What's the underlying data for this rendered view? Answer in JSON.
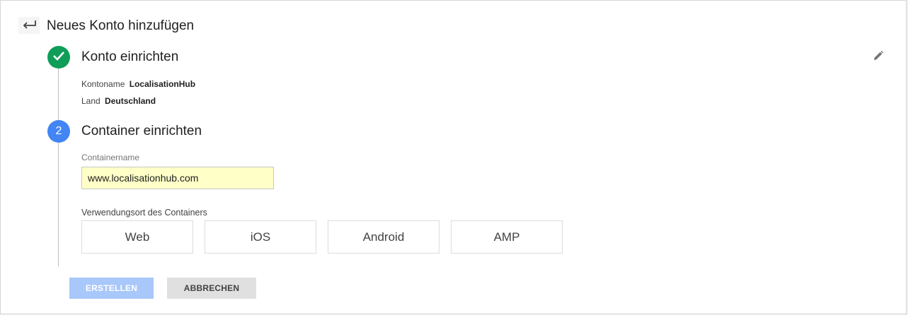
{
  "header": {
    "title": "Neues Konto hinzufügen",
    "back_icon": "arrow-back-icon"
  },
  "step1": {
    "title": "Konto einrichten",
    "status_icon": "check-icon",
    "edit_icon": "pencil-icon",
    "account_name_label": "Kontoname",
    "account_name_value": "LocalisationHub",
    "country_label": "Land",
    "country_value": "Deutschland"
  },
  "step2": {
    "number": "2",
    "title": "Container einrichten",
    "container_name_label": "Containername",
    "container_name_value": "www.localisationhub.com",
    "usage_label": "Verwendungsort des Containers",
    "platforms": [
      "Web",
      "iOS",
      "Android",
      "AMP"
    ]
  },
  "actions": {
    "create_label": "ERSTELLEN",
    "cancel_label": "ABBRECHEN"
  },
  "colors": {
    "done": "#0f9d58",
    "active": "#4285f4",
    "input_bg": "#ffffc8",
    "create_disabled": "#a8c7fa"
  }
}
